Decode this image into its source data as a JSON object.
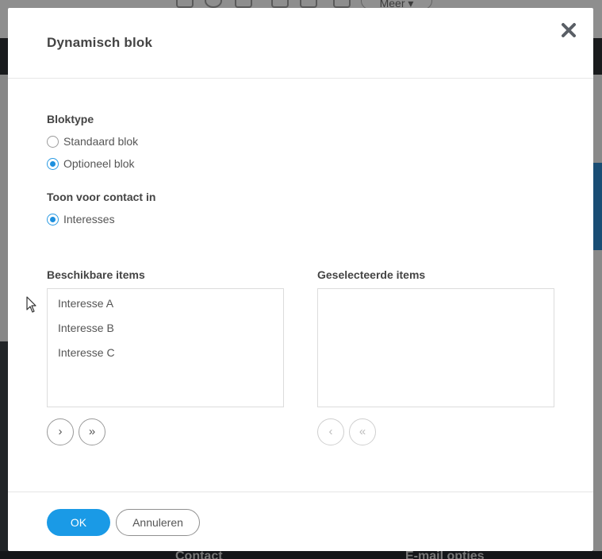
{
  "background": {
    "toolbar": {
      "more_label": "Meer ▾"
    },
    "bottom_labels": [
      "Contact",
      "E-mail opties"
    ]
  },
  "modal": {
    "title": "Dynamisch blok",
    "close_icon": "close-icon",
    "blocktype": {
      "label": "Bloktype",
      "options": [
        {
          "label": "Standaard blok",
          "checked": false
        },
        {
          "label": "Optioneel blok",
          "checked": true
        }
      ]
    },
    "show_for_contact": {
      "label": "Toon voor contact in",
      "options": [
        {
          "label": "Interesses",
          "checked": true
        }
      ]
    },
    "available": {
      "label": "Beschikbare items",
      "items": [
        "Interesse A",
        "Interesse B",
        "Interesse C"
      ]
    },
    "selected": {
      "label": "Geselecteerde items",
      "items": []
    },
    "move_buttons": {
      "add_one": "›",
      "add_all": "»",
      "remove_one": "‹",
      "remove_all": "«"
    },
    "footer": {
      "ok_label": "OK",
      "cancel_label": "Annuleren"
    }
  },
  "colors": {
    "accent": "#1a9ae6",
    "overlay": "rgba(0,0,0,0.42)"
  }
}
